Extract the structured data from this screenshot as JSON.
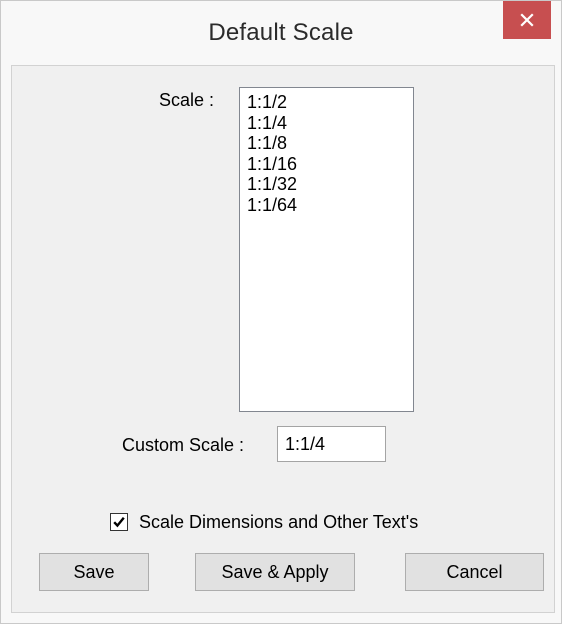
{
  "window": {
    "title": "Default Scale",
    "close_icon": "close-x-icon",
    "close_color": "#c74f50"
  },
  "scale": {
    "label": "Scale :",
    "options": [
      "1:1/2",
      "1:1/4",
      "1:1/8",
      "1:1/16",
      "1:1/32",
      "1:1/64"
    ]
  },
  "custom_scale": {
    "label": "Custom Scale :",
    "value": "1:1/4"
  },
  "checkbox": {
    "label": "Scale Dimensions and Other Text's",
    "checked": true
  },
  "buttons": {
    "save": "Save",
    "save_apply": "Save & Apply",
    "cancel": "Cancel"
  }
}
